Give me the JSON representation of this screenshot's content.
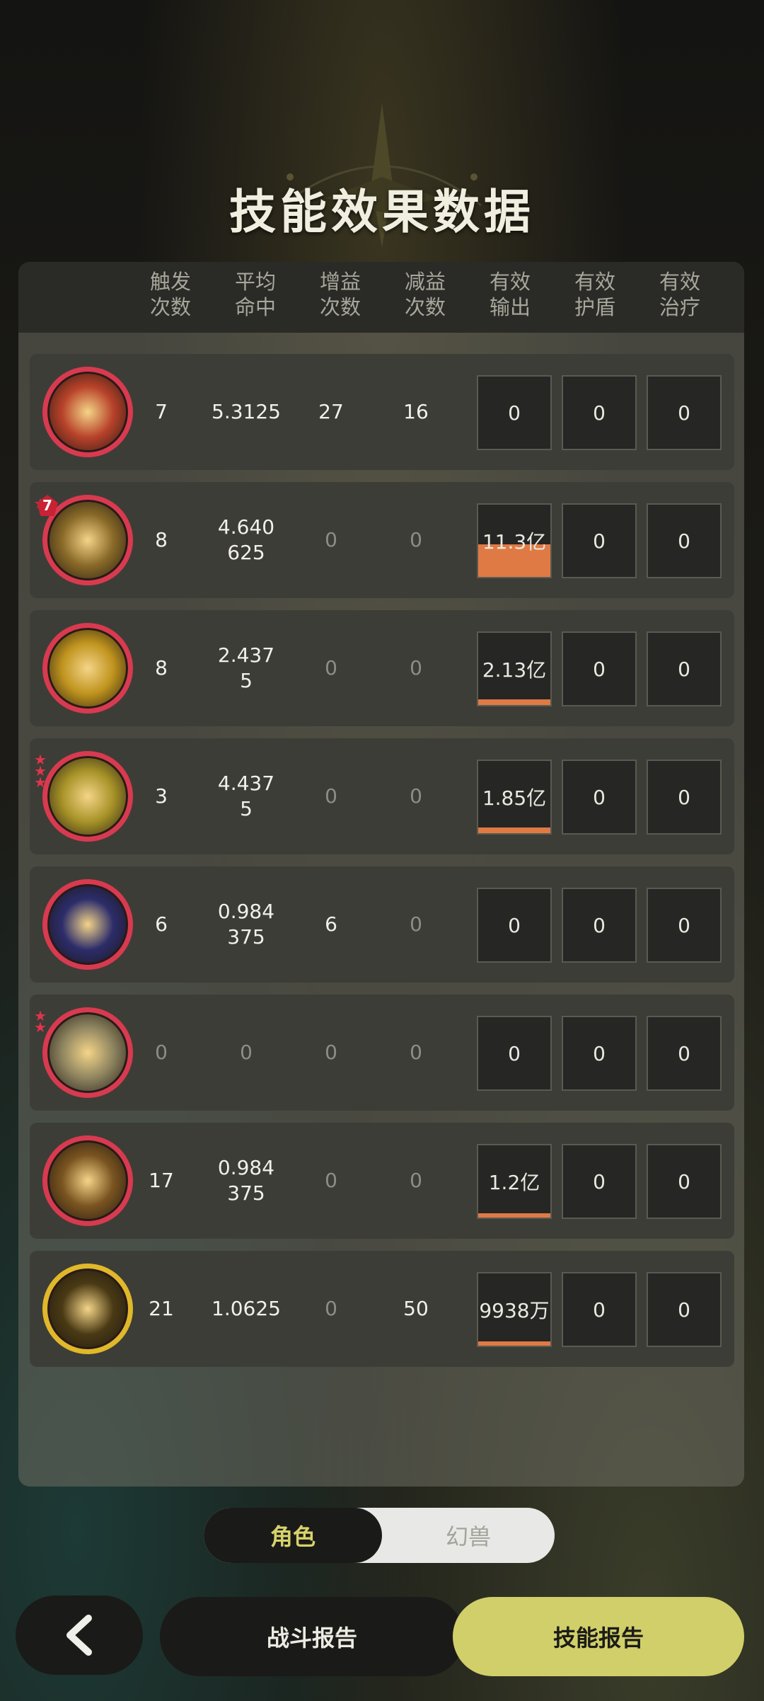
{
  "title": "技能效果数据",
  "headers": [
    "触发\n次数",
    "平均\n命中",
    "增益\n次数",
    "减益\n次数",
    "有效\n输出",
    "有效\n护盾",
    "有效\n治疗"
  ],
  "rows": [
    {
      "icon": "explosion-skill-icon",
      "ring": "#d83a50",
      "core": "#b8422a",
      "stars": 0,
      "badge": "",
      "trigger": "7",
      "avg_hit": "5.3125",
      "buff": "27",
      "debuff": "16",
      "output": "0",
      "output_fill": 0,
      "shield": "0",
      "heal": "0"
    },
    {
      "icon": "lightning-star-skill-icon",
      "ring": "#d83a50",
      "core": "#8a6a28",
      "stars": 1,
      "badge": "7",
      "trigger": "8",
      "avg_hit": "4.640\n625",
      "buff": "0",
      "debuff": "0",
      "output": "11.3亿",
      "output_fill": 0.45,
      "shield": "0",
      "heal": "0"
    },
    {
      "icon": "golden-burst-skill-icon",
      "ring": "#d83a50",
      "core": "#c0941e",
      "stars": 0,
      "badge": "",
      "trigger": "8",
      "avg_hit": "2.437\n5",
      "buff": "0",
      "debuff": "0",
      "output": "2.13亿",
      "output_fill": 0.08,
      "shield": "0",
      "heal": "0"
    },
    {
      "icon": "thunder-orb-skill-icon",
      "ring": "#d83a50",
      "core": "#a89328",
      "stars": 3,
      "badge": "",
      "trigger": "3",
      "avg_hit": "4.437\n5",
      "buff": "0",
      "debuff": "0",
      "output": "1.85亿",
      "output_fill": 0.08,
      "shield": "0",
      "heal": "0"
    },
    {
      "icon": "arcane-sphere-skill-icon",
      "ring": "#d83a50",
      "core": "#2c2d6a",
      "stars": 0,
      "badge": "",
      "trigger": "6",
      "avg_hit": "0.984\n375",
      "buff": "6",
      "debuff": "0",
      "output": "0",
      "output_fill": 0,
      "shield": "0",
      "heal": "0"
    },
    {
      "icon": "arrow-rise-skill-icon",
      "ring": "#d83a50",
      "core": "#8f8560",
      "stars": 2,
      "badge": "",
      "trigger": "0",
      "avg_hit": "0",
      "buff": "0",
      "debuff": "0",
      "output": "0",
      "output_fill": 0,
      "shield": "0",
      "heal": "0"
    },
    {
      "icon": "strike-skill-icon",
      "ring": "#d83a50",
      "core": "#7a5420",
      "stars": 0,
      "badge": "",
      "trigger": "17",
      "avg_hit": "0.984\n375",
      "buff": "0",
      "debuff": "0",
      "output": "1.2亿",
      "output_fill": 0.05,
      "shield": "0",
      "heal": "0"
    },
    {
      "icon": "golden-crown-skill-icon",
      "ring": "#e0b82a",
      "core": "#4a3a14",
      "stars": 0,
      "badge": "",
      "trigger": "21",
      "avg_hit": "1.0625",
      "buff": "0",
      "debuff": "50",
      "output": "9938万",
      "output_fill": 0.05,
      "shield": "0",
      "heal": "0"
    }
  ],
  "toggle": {
    "active": "角色",
    "inactive": "幻兽"
  },
  "footer": {
    "battle_report": "战斗报告",
    "skill_report": "技能报告"
  }
}
